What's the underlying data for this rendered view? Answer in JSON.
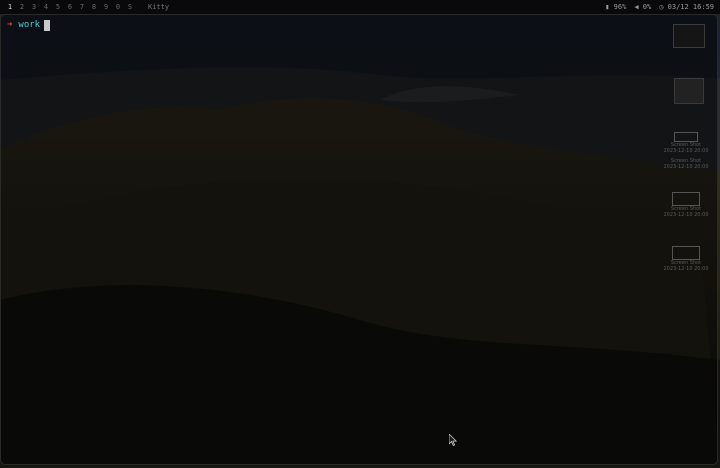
{
  "topbar": {
    "workspaces": [
      "1",
      "2",
      "3",
      "4",
      "5",
      "6",
      "7",
      "8",
      "9",
      "0",
      "S"
    ],
    "active_workspace": "1",
    "window_title": "Kitty",
    "battery": "96%",
    "volume": "0%",
    "datetime": "03/12 16:59",
    "icons": [
      "battery-icon",
      "volume-icon",
      "clock-icon"
    ]
  },
  "terminal": {
    "prompt_symbol": "➜",
    "directory": "work"
  },
  "desktop_icons": [
    {
      "name": "",
      "date": ""
    },
    {
      "name": "",
      "date": ""
    },
    {
      "name": "Screen Shot",
      "date": "2023-12-10 20:00"
    },
    {
      "name": "Screen Shot",
      "date": "2023-12-10 20:00"
    },
    {
      "name": "Screen Shot",
      "date": "2023-12-10 20:00"
    },
    {
      "name": "Screen Shot",
      "date": "2023-12-10 20:00"
    }
  ],
  "colors": {
    "prompt_arrow": "#e04a3a",
    "directory": "#3fd0d8",
    "cursor": "#c9c9c9"
  }
}
